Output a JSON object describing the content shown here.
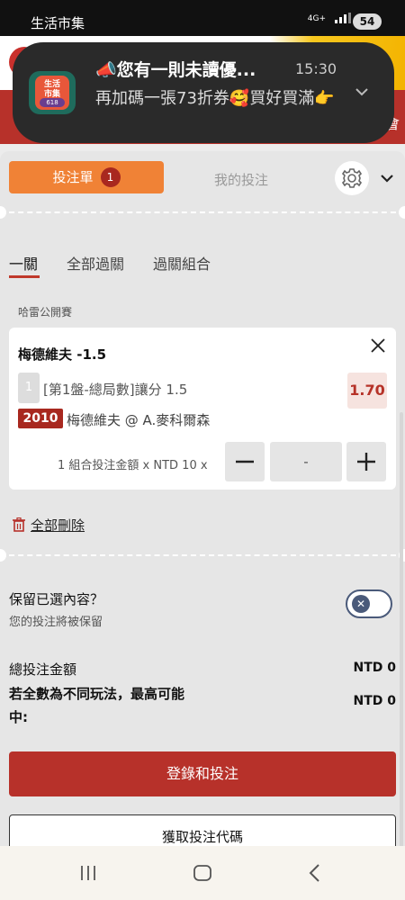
{
  "status_bar": {
    "app_name": "生活市集",
    "network": "4G+",
    "battery": "54"
  },
  "background": {
    "right_text": "會"
  },
  "notification": {
    "app_icon_text": "生活\n市集",
    "app_icon_tag": "618",
    "title": "📣您有一則未讀優...",
    "time": "15:30",
    "body": "再加碼一張73折券🥰買好買滿👉"
  },
  "betslip": {
    "tabs": {
      "betslip_label": "投注單",
      "betslip_count": "1",
      "mybets_label": "我的投注"
    },
    "sub_tabs": [
      "一關",
      "全部過關",
      "過關組合"
    ],
    "tournament": "哈雷公開賽",
    "selection": {
      "name": "梅德維夫 -1.5",
      "leg_number": "1",
      "market": "[第1盤-總局數]讓分 1.5",
      "odds": "1.70",
      "match_code": "2010",
      "match": "梅德維夫 @ A.麥科爾森",
      "amount_label": "1 組合投注金額 x NTD 10 x",
      "stake_value": "-"
    },
    "delete_all": "全部刪除",
    "keep_selection": {
      "title": "保留已選內容？",
      "subtitle": "您的投注將被保留",
      "enabled": false
    },
    "totals": {
      "total_label": "總投注金額",
      "total_value": "NTD 0",
      "max_label": "若全數為不同玩法，最高可能中:",
      "max_value": "NTD 0"
    },
    "login_button": "登錄和投注",
    "code_button": "獲取投注代碼"
  },
  "colors": {
    "accent_orange": "#f08236",
    "brand_red": "#b7312a",
    "odds_bg": "#f6e3df"
  }
}
